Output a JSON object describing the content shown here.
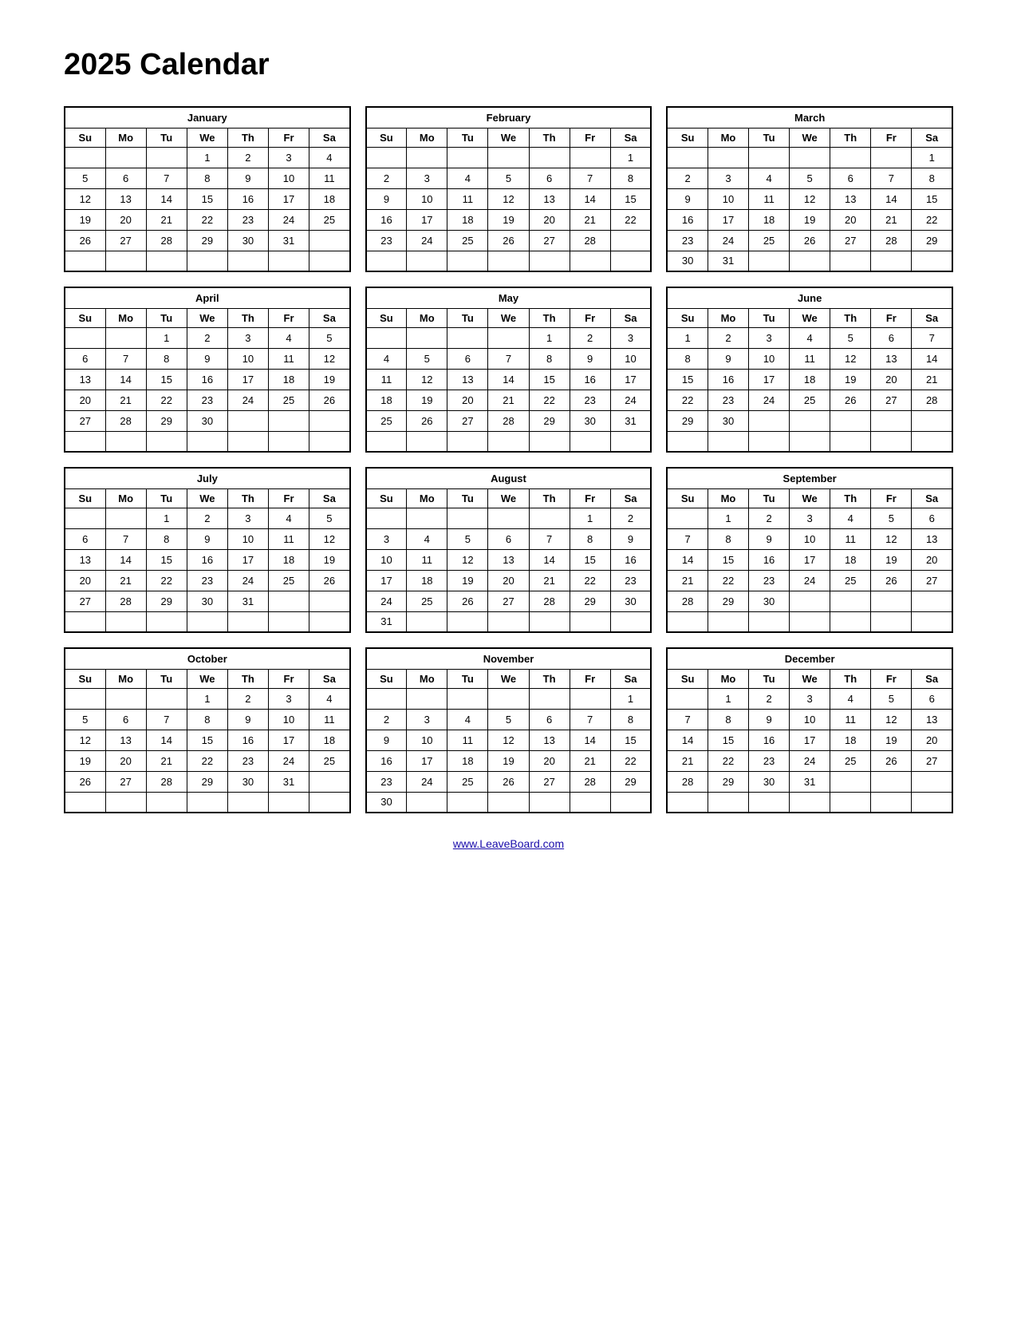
{
  "title": "2025 Calendar",
  "footer_link": "www.LeaveBoard.com",
  "days_header": [
    "Su",
    "Mo",
    "Tu",
    "We",
    "Th",
    "Fr",
    "Sa"
  ],
  "months": [
    {
      "name": "January",
      "weeks": [
        [
          "",
          "",
          "",
          "1",
          "2",
          "3",
          "4"
        ],
        [
          "5",
          "6",
          "7",
          "8",
          "9",
          "10",
          "11"
        ],
        [
          "12",
          "13",
          "14",
          "15",
          "16",
          "17",
          "18"
        ],
        [
          "19",
          "20",
          "21",
          "22",
          "23",
          "24",
          "25"
        ],
        [
          "26",
          "27",
          "28",
          "29",
          "30",
          "31",
          ""
        ],
        [
          "",
          "",
          "",
          "",
          "",
          "",
          ""
        ]
      ]
    },
    {
      "name": "February",
      "weeks": [
        [
          "",
          "",
          "",
          "",
          "",
          "",
          "1"
        ],
        [
          "2",
          "3",
          "4",
          "5",
          "6",
          "7",
          "8"
        ],
        [
          "9",
          "10",
          "11",
          "12",
          "13",
          "14",
          "15"
        ],
        [
          "16",
          "17",
          "18",
          "19",
          "20",
          "21",
          "22"
        ],
        [
          "23",
          "24",
          "25",
          "26",
          "27",
          "28",
          ""
        ],
        [
          "",
          "",
          "",
          "",
          "",
          "",
          ""
        ]
      ]
    },
    {
      "name": "March",
      "weeks": [
        [
          "",
          "",
          "",
          "",
          "",
          "",
          "1"
        ],
        [
          "2",
          "3",
          "4",
          "5",
          "6",
          "7",
          "8"
        ],
        [
          "9",
          "10",
          "11",
          "12",
          "13",
          "14",
          "15"
        ],
        [
          "16",
          "17",
          "18",
          "19",
          "20",
          "21",
          "22"
        ],
        [
          "23",
          "24",
          "25",
          "26",
          "27",
          "28",
          "29"
        ],
        [
          "30",
          "31",
          "",
          "",
          "",
          "",
          ""
        ]
      ]
    },
    {
      "name": "April",
      "weeks": [
        [
          "",
          "",
          "1",
          "2",
          "3",
          "4",
          "5"
        ],
        [
          "6",
          "7",
          "8",
          "9",
          "10",
          "11",
          "12"
        ],
        [
          "13",
          "14",
          "15",
          "16",
          "17",
          "18",
          "19"
        ],
        [
          "20",
          "21",
          "22",
          "23",
          "24",
          "25",
          "26"
        ],
        [
          "27",
          "28",
          "29",
          "30",
          "",
          "",
          ""
        ],
        [
          "",
          "",
          "",
          "",
          "",
          "",
          ""
        ]
      ]
    },
    {
      "name": "May",
      "weeks": [
        [
          "",
          "",
          "",
          "",
          "1",
          "2",
          "3"
        ],
        [
          "4",
          "5",
          "6",
          "7",
          "8",
          "9",
          "10"
        ],
        [
          "11",
          "12",
          "13",
          "14",
          "15",
          "16",
          "17"
        ],
        [
          "18",
          "19",
          "20",
          "21",
          "22",
          "23",
          "24"
        ],
        [
          "25",
          "26",
          "27",
          "28",
          "29",
          "30",
          "31"
        ],
        [
          "",
          "",
          "",
          "",
          "",
          "",
          ""
        ]
      ]
    },
    {
      "name": "June",
      "weeks": [
        [
          "1",
          "2",
          "3",
          "4",
          "5",
          "6",
          "7"
        ],
        [
          "8",
          "9",
          "10",
          "11",
          "12",
          "13",
          "14"
        ],
        [
          "15",
          "16",
          "17",
          "18",
          "19",
          "20",
          "21"
        ],
        [
          "22",
          "23",
          "24",
          "25",
          "26",
          "27",
          "28"
        ],
        [
          "29",
          "30",
          "",
          "",
          "",
          "",
          ""
        ],
        [
          "",
          "",
          "",
          "",
          "",
          "",
          ""
        ]
      ]
    },
    {
      "name": "July",
      "weeks": [
        [
          "",
          "",
          "1",
          "2",
          "3",
          "4",
          "5"
        ],
        [
          "6",
          "7",
          "8",
          "9",
          "10",
          "11",
          "12"
        ],
        [
          "13",
          "14",
          "15",
          "16",
          "17",
          "18",
          "19"
        ],
        [
          "20",
          "21",
          "22",
          "23",
          "24",
          "25",
          "26"
        ],
        [
          "27",
          "28",
          "29",
          "30",
          "31",
          "",
          ""
        ],
        [
          "",
          "",
          "",
          "",
          "",
          "",
          ""
        ]
      ]
    },
    {
      "name": "August",
      "weeks": [
        [
          "",
          "",
          "",
          "",
          "",
          "1",
          "2"
        ],
        [
          "3",
          "4",
          "5",
          "6",
          "7",
          "8",
          "9"
        ],
        [
          "10",
          "11",
          "12",
          "13",
          "14",
          "15",
          "16"
        ],
        [
          "17",
          "18",
          "19",
          "20",
          "21",
          "22",
          "23"
        ],
        [
          "24",
          "25",
          "26",
          "27",
          "28",
          "29",
          "30"
        ],
        [
          "31",
          "",
          "",
          "",
          "",
          "",
          ""
        ]
      ]
    },
    {
      "name": "September",
      "weeks": [
        [
          "",
          "1",
          "2",
          "3",
          "4",
          "5",
          "6"
        ],
        [
          "7",
          "8",
          "9",
          "10",
          "11",
          "12",
          "13"
        ],
        [
          "14",
          "15",
          "16",
          "17",
          "18",
          "19",
          "20"
        ],
        [
          "21",
          "22",
          "23",
          "24",
          "25",
          "26",
          "27"
        ],
        [
          "28",
          "29",
          "30",
          "",
          "",
          "",
          ""
        ],
        [
          "",
          "",
          "",
          "",
          "",
          "",
          ""
        ]
      ]
    },
    {
      "name": "October",
      "weeks": [
        [
          "",
          "",
          "",
          "1",
          "2",
          "3",
          "4"
        ],
        [
          "5",
          "6",
          "7",
          "8",
          "9",
          "10",
          "11"
        ],
        [
          "12",
          "13",
          "14",
          "15",
          "16",
          "17",
          "18"
        ],
        [
          "19",
          "20",
          "21",
          "22",
          "23",
          "24",
          "25"
        ],
        [
          "26",
          "27",
          "28",
          "29",
          "30",
          "31",
          ""
        ],
        [
          "",
          "",
          "",
          "",
          "",
          "",
          ""
        ]
      ]
    },
    {
      "name": "November",
      "weeks": [
        [
          "",
          "",
          "",
          "",
          "",
          "",
          "1"
        ],
        [
          "2",
          "3",
          "4",
          "5",
          "6",
          "7",
          "8"
        ],
        [
          "9",
          "10",
          "11",
          "12",
          "13",
          "14",
          "15"
        ],
        [
          "16",
          "17",
          "18",
          "19",
          "20",
          "21",
          "22"
        ],
        [
          "23",
          "24",
          "25",
          "26",
          "27",
          "28",
          "29"
        ],
        [
          "30",
          "",
          "",
          "",
          "",
          "",
          ""
        ]
      ]
    },
    {
      "name": "December",
      "weeks": [
        [
          "",
          "1",
          "2",
          "3",
          "4",
          "5",
          "6"
        ],
        [
          "7",
          "8",
          "9",
          "10",
          "11",
          "12",
          "13"
        ],
        [
          "14",
          "15",
          "16",
          "17",
          "18",
          "19",
          "20"
        ],
        [
          "21",
          "22",
          "23",
          "24",
          "25",
          "26",
          "27"
        ],
        [
          "28",
          "29",
          "30",
          "31",
          "",
          "",
          ""
        ],
        [
          "",
          "",
          "",
          "",
          "",
          "",
          ""
        ]
      ]
    }
  ]
}
